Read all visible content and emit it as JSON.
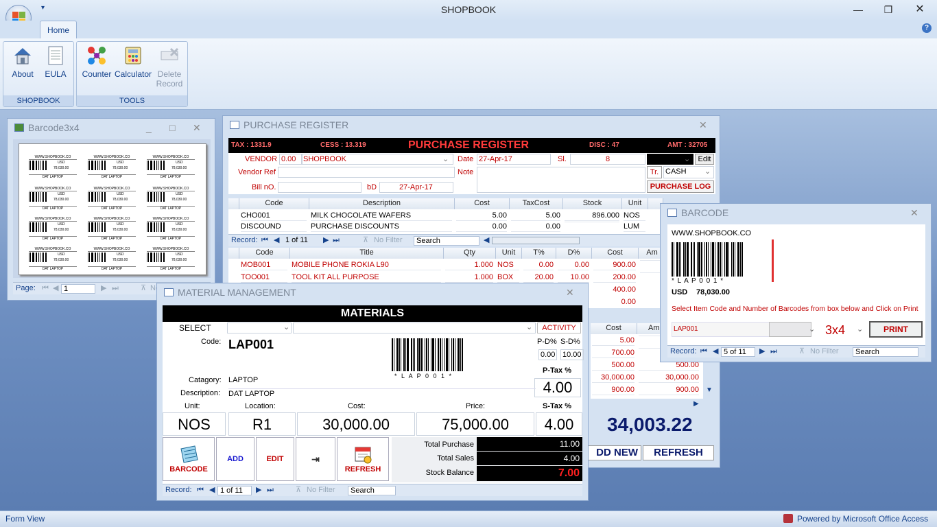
{
  "app": {
    "title": "SHOPBOOK"
  },
  "ribbon": {
    "tab": "Home",
    "groups": [
      {
        "label": "SHOPBOOK",
        "buttons": [
          "About",
          "EULA"
        ]
      },
      {
        "label": "TOOLS",
        "buttons": [
          "Counter",
          "Calculator",
          "Delete Record"
        ]
      }
    ]
  },
  "barcode3x4": {
    "title": "Barcode3x4",
    "label_site": "WWW.SHOPBOOK.CO",
    "label_currency": "USD",
    "label_price": "78,030.00",
    "label_title": "DAT LAPTOP",
    "page_label": "Page:",
    "page_value": "1",
    "filter": "No F"
  },
  "purchase": {
    "title": "PURCHASE REGISTER",
    "tax": "TAX : 1331.9",
    "cess": "CESS : 13.319",
    "heading": "PURCHASE REGISTER",
    "disc": "DISC : 47",
    "amt": "AMT : 32705",
    "vendor_label": "VENDOR",
    "vendor_value": "0.00",
    "vendor_name": "SHOPBOOK",
    "date_label": "Date",
    "date_value": "27-Apr-17",
    "sl_label": "Sl.",
    "sl_value": "8",
    "edit": "Edit",
    "vendor_ref_label": "Vendor Ref",
    "note_label": "Note",
    "tr_label": "Tr.",
    "tr_value": "CASH",
    "bill_label": "Bill nO.",
    "bd_label": "bD",
    "bd_value": "27-Apr-17",
    "log_button": "PURCHASE LOG",
    "top_headers": [
      "Code",
      "Description",
      "Cost",
      "TaxCost",
      "Stock",
      "Unit"
    ],
    "top_rows": [
      [
        "CHO001",
        "MILK CHOCOLATE WAFERS",
        "5.00",
        "5.00",
        "896.000",
        "NOS"
      ],
      [
        "DISCOUND",
        "PURCHASE DISCOUNTS",
        "0.00",
        "0.00",
        "",
        "LUM"
      ]
    ],
    "top_nav": {
      "record": "Record:",
      "pos": "1 of 11",
      "filter": "No Filter",
      "search": "Search"
    },
    "bottom_headers": [
      "Code",
      "Title",
      "Qty",
      "Unit",
      "T%",
      "D%",
      "Cost",
      "Am"
    ],
    "bottom_rows": [
      [
        "MOB001",
        "MOBILE PHONE ROKIA L90",
        "1.000",
        "NOS",
        "0.00",
        "0.00",
        "900.00",
        ""
      ],
      [
        "TOO001",
        "TOOL KIT ALL PURPOSE",
        "1.000",
        "BOX",
        "20.00",
        "10.00",
        "200.00",
        ""
      ]
    ],
    "peek_costs_top": [
      "400.00",
      "0.00"
    ],
    "cost_header2": "Cost",
    "am_header2": "Am",
    "right_costs": [
      "5.00",
      "700.00",
      "500.00",
      "30,000.00",
      "900.00"
    ],
    "right_amounts": [
      "",
      "",
      "500.00",
      "30,000.00",
      "900.00"
    ],
    "total": "34,003.22",
    "add_new": "DD NEW",
    "refresh": "REFRESH"
  },
  "barcode": {
    "title": "BARCODE",
    "site": "WWW.SHOPBOOK.CO",
    "code_text": "* L A P 0 0 1 *",
    "currency": "USD",
    "price": "78,030.00",
    "instruction": "Select Item Code and Number of Barcodes from box below and Click on Print",
    "item_code": "LAP001",
    "layout": "3x4",
    "print": "PRINT",
    "nav": {
      "record": "Record:",
      "pos": "5 of 11",
      "filter": "No Filter",
      "search": "Search"
    }
  },
  "materials": {
    "title": "MATERIAL MANAGEMENT",
    "heading": "MATERIALS",
    "select_label": "SELECT",
    "activity": "ACTIVITY",
    "code_label": "Code:",
    "code_value": "LAP001",
    "code_text": "* L A P 0 0 1 *",
    "pd_label": "P-D%",
    "sd_label": "S-D%",
    "pd_value": "0.00",
    "sd_value": "10.00",
    "ptax_label": "P-Tax %",
    "ptax_value": "4.00",
    "category_label": "Catagory:",
    "category_value": "LAPTOP",
    "description_label": "Description:",
    "description_value": "DAT LAPTOP",
    "unit_label": "Unit:",
    "location_label": "Location:",
    "cost_label": "Cost:",
    "price_label": "Price:",
    "stax_label": "S-Tax %",
    "unit_value": "NOS",
    "location_value": "R1",
    "cost_value": "30,000.00",
    "price_value": "75,000.00",
    "stax_value": "4.00",
    "btn_barcode": "BARCODE",
    "btn_add": "ADD",
    "btn_edit": "EDIT",
    "btn_refresh": "REFRESH",
    "total_purchase_label": "Total Purchase",
    "total_purchase": "11.00",
    "total_sales_label": "Total Sales",
    "total_sales": "4.00",
    "stock_balance_label": "Stock Balance",
    "stock_balance": "7.00",
    "nav": {
      "record": "Record:",
      "pos": "1 of 11",
      "filter": "No Filter",
      "search": "Search"
    }
  },
  "status": {
    "left": "Form View",
    "right": "Powered by Microsoft Office Access"
  },
  "colors": {
    "accent": "#15428b",
    "red": "#c00000",
    "navy": "#0a1a6b"
  }
}
